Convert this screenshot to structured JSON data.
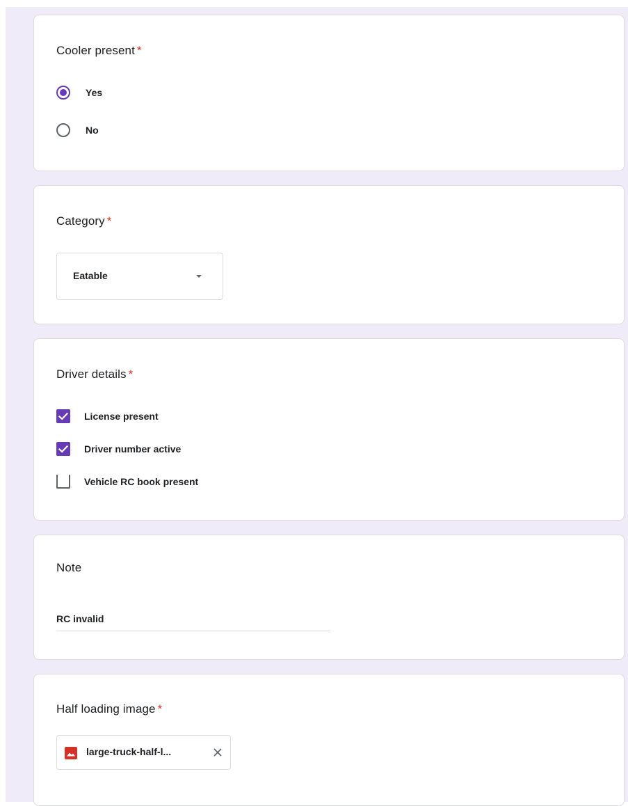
{
  "questions": {
    "cooler": {
      "title": "Cooler present",
      "required_mark": "*",
      "options": [
        {
          "label": "Yes",
          "selected": true
        },
        {
          "label": "No",
          "selected": false
        }
      ]
    },
    "category": {
      "title": "Category",
      "required_mark": "*",
      "selected_value": "Eatable"
    },
    "driver": {
      "title": "Driver details",
      "required_mark": "*",
      "options": [
        {
          "label": "License present",
          "checked": true
        },
        {
          "label": "Driver number active",
          "checked": true
        },
        {
          "label": "Vehicle RC book present",
          "checked": false
        }
      ]
    },
    "note": {
      "title": "Note",
      "value": "RC invalid"
    },
    "image": {
      "title": "Half loading image",
      "required_mark": "*",
      "file_name": "large-truck-half-l...",
      "file_icon": "image-file-icon",
      "remove_icon": "close-icon"
    }
  },
  "colors": {
    "accent": "#673ab7",
    "required": "#d93025",
    "page_background": "#f0ebf8",
    "card_border": "#dadce0"
  }
}
